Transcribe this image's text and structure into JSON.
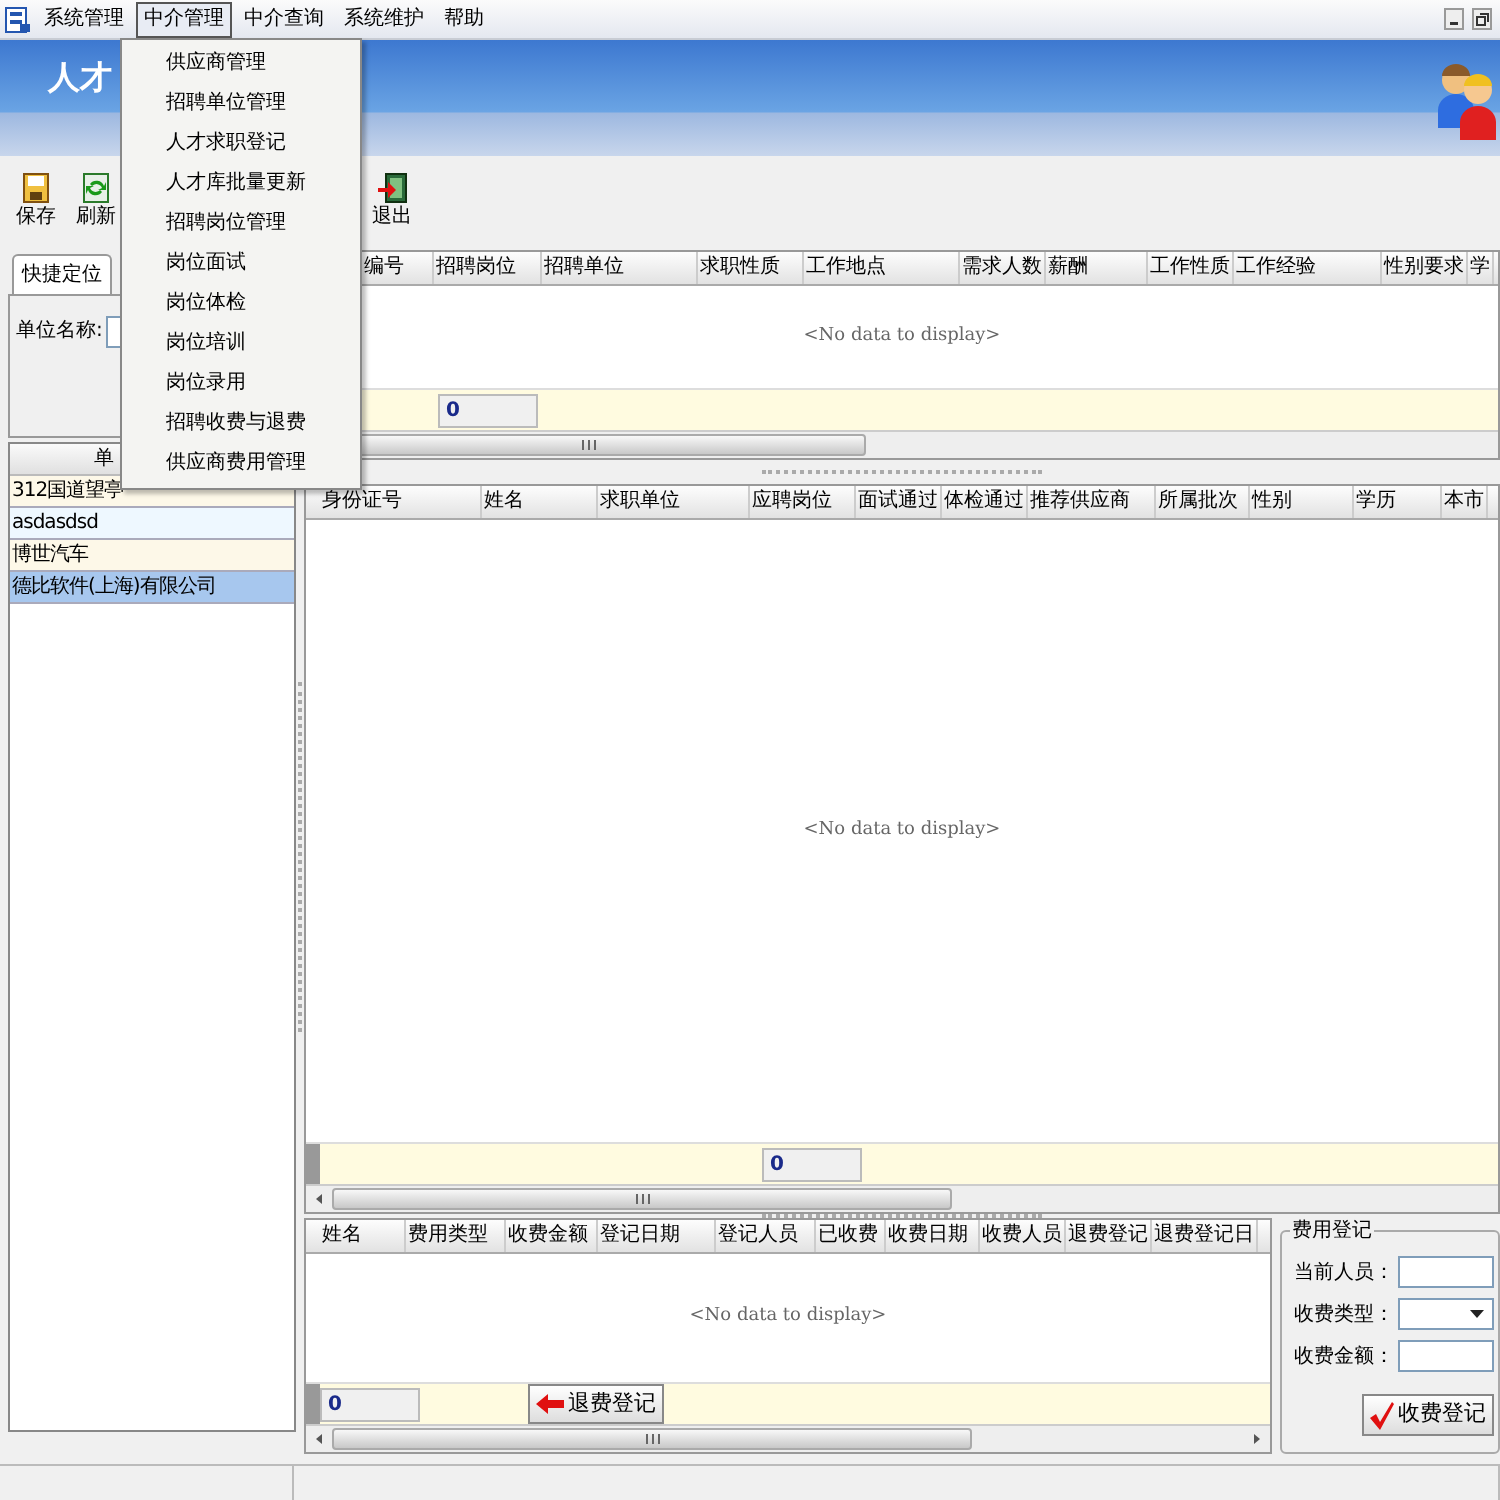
{
  "menubar": {
    "items": [
      {
        "label": "系统管理",
        "selected": false
      },
      {
        "label": "中介管理",
        "selected": true
      },
      {
        "label": "中介查询",
        "selected": false
      },
      {
        "label": "系统维护",
        "selected": false
      },
      {
        "label": "帮助",
        "selected": false
      }
    ]
  },
  "open_menu": {
    "items": [
      "供应商管理",
      "招聘单位管理",
      "人才求职登记",
      "人才库批量更新",
      "招聘岗位管理",
      "岗位面试",
      "岗位体检",
      "岗位培训",
      "岗位录用",
      "招聘收费与退费",
      "供应商费用管理"
    ]
  },
  "banner": {
    "title": "人才"
  },
  "toolbar": {
    "buttons": [
      {
        "label": "保存",
        "kind": "save"
      },
      {
        "label": "刷新",
        "kind": "refresh"
      },
      {
        "label": "退出",
        "kind": "exit"
      }
    ]
  },
  "left_panel": {
    "tab": {
      "label": "快捷定位",
      "selected": true
    },
    "unit_label": "单位名称:",
    "list": {
      "header": "单",
      "rows": [
        {
          "text": "312国道望亭",
          "selected": false
        },
        {
          "text": "asdasdsd",
          "selected": false
        },
        {
          "text": "博世汽车",
          "selected": false
        },
        {
          "text": "德比软件(上海)有限公司",
          "selected": true
        }
      ]
    }
  },
  "top_grid": {
    "columns": [
      "编号",
      "招聘岗位",
      "招聘单位",
      "求职性质",
      "工作地点",
      "需求人数",
      "薪酬",
      "工作性质",
      "工作经验",
      "性别要求",
      "学"
    ],
    "empty_text": "<No data to display>",
    "footer_value": "0"
  },
  "middle_grid": {
    "columns": [
      "身份证号",
      "姓名",
      "求职单位",
      "应聘岗位",
      "面试通过",
      "体检通过",
      "推荐供应商",
      "所属批次",
      "性别",
      "学历",
      "本市"
    ],
    "empty_text": "<No data to display>",
    "footer_value": "0"
  },
  "bottom_grid": {
    "columns": [
      "姓名",
      "费用类型",
      "收费金额",
      "登记日期",
      "登记人员",
      "已收费",
      "收费日期",
      "收费人员",
      "退费登记",
      "退费登记日"
    ],
    "empty_text": "<No data to display>",
    "footer_value": "0",
    "refund_button": "退费登记"
  },
  "fee_panel": {
    "title": "费用登记",
    "fields": [
      {
        "label": "当前人员：",
        "kind": "text"
      },
      {
        "label": "收费类型：",
        "kind": "select"
      },
      {
        "label": "收费金额：",
        "kind": "text"
      }
    ],
    "submit_button": "收费登记"
  }
}
